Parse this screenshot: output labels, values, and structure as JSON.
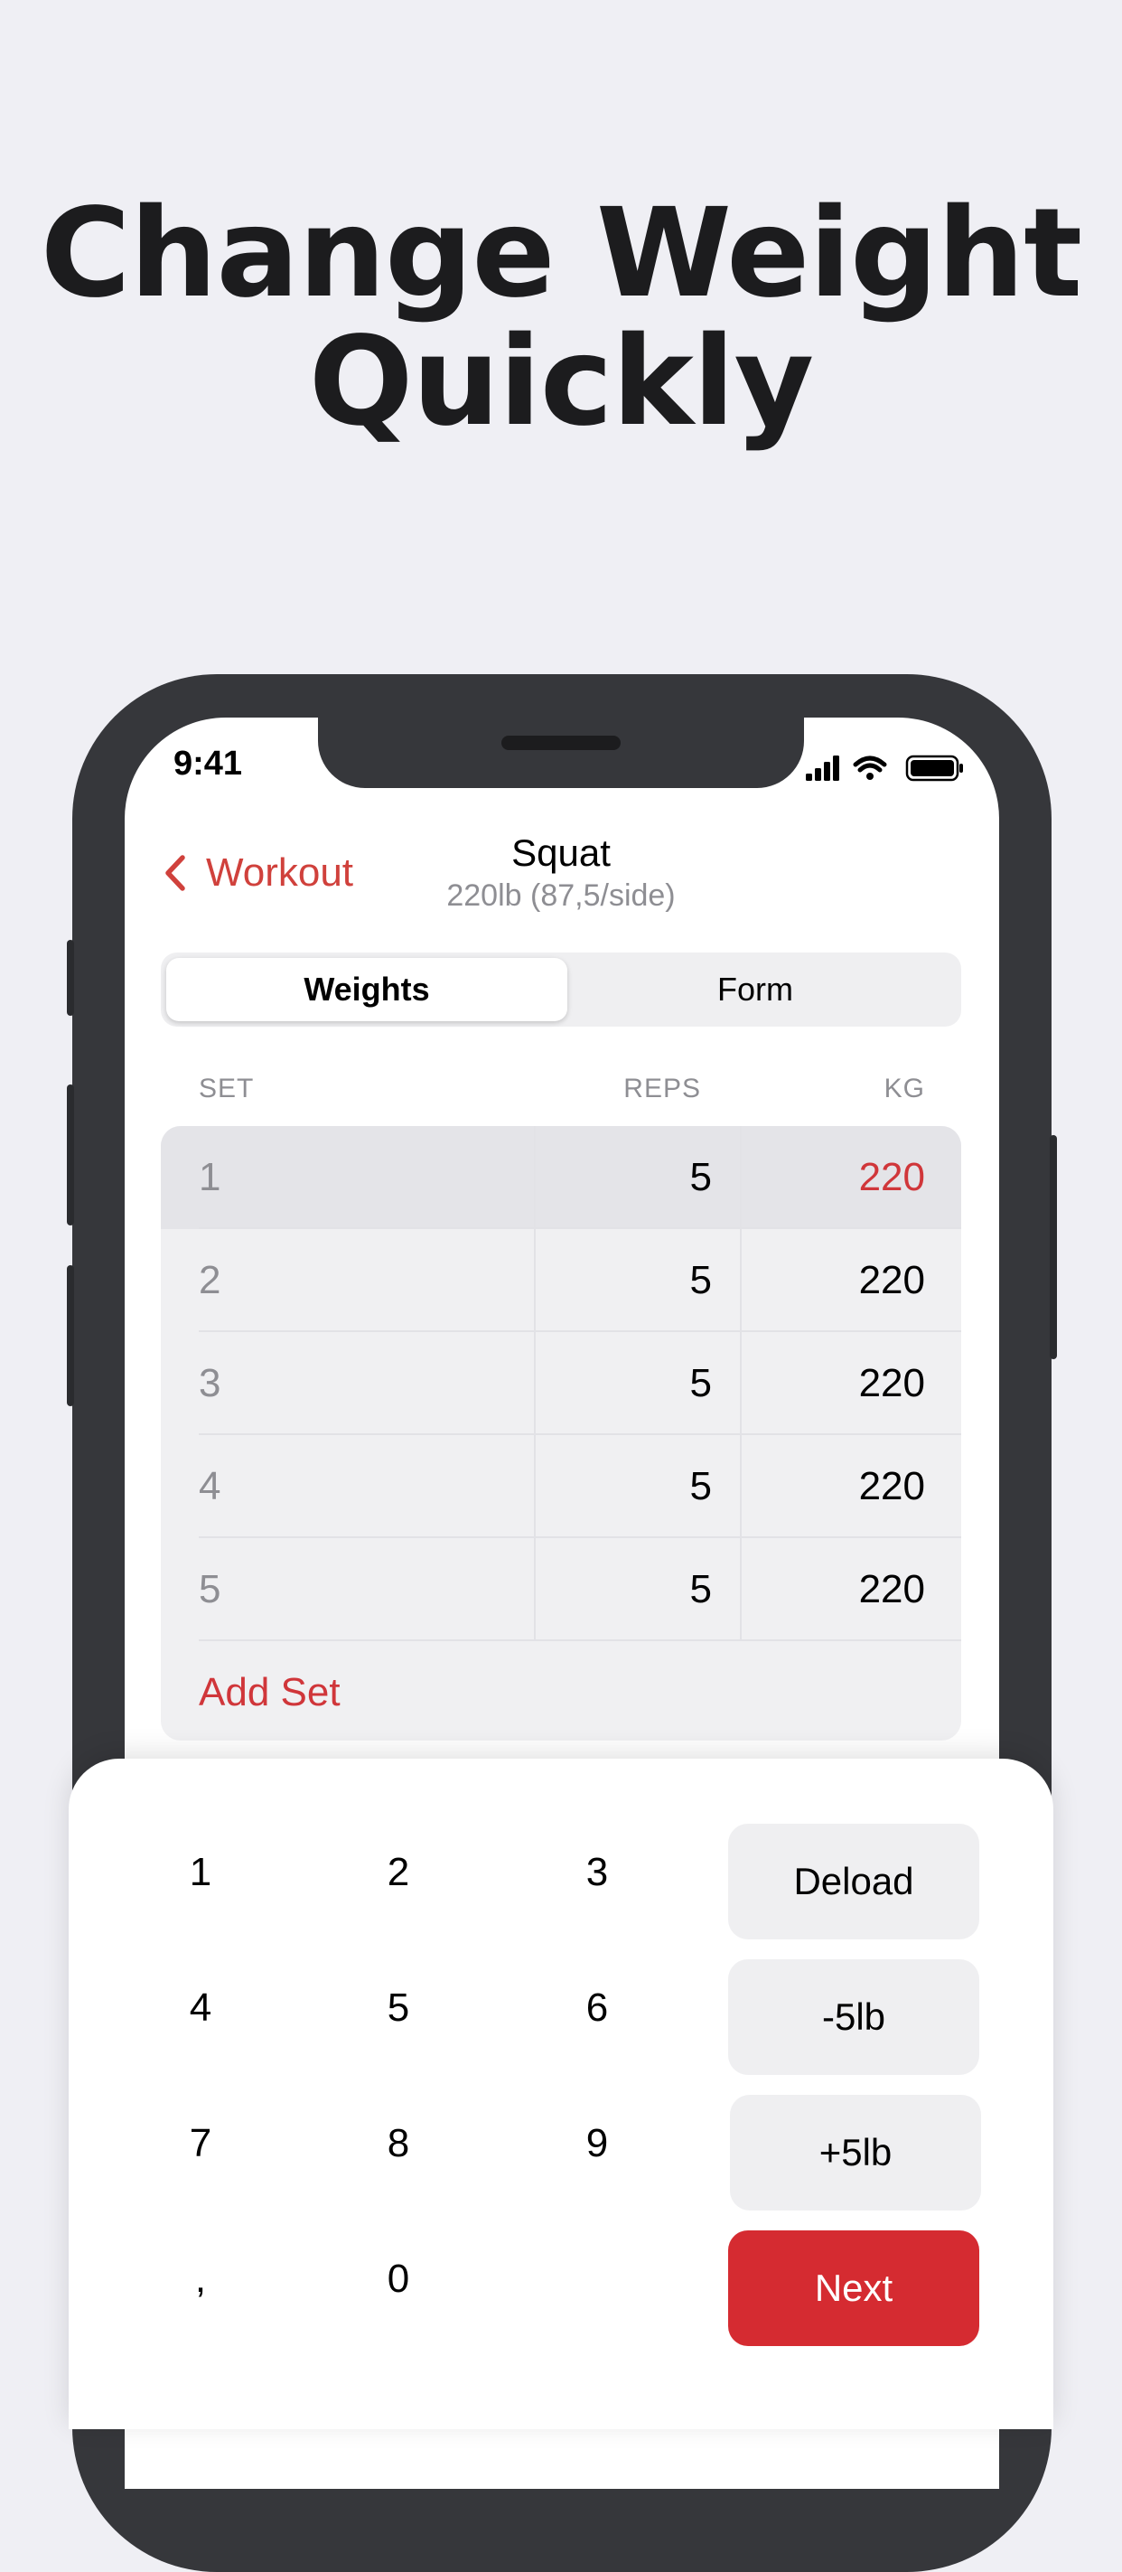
{
  "headline": {
    "line1": "Change Weight",
    "line2": "Quickly"
  },
  "status_bar": {
    "time": "9:41",
    "icons": [
      "signal-icon",
      "wifi-icon",
      "battery-icon"
    ]
  },
  "nav": {
    "back_label": "Workout",
    "title": "Squat",
    "subtitle": "220lb (87,5/side)"
  },
  "segments": {
    "weights": "Weights",
    "form": "Form",
    "selected": "Weights"
  },
  "table": {
    "headers": {
      "set": "SET",
      "reps": "REPS",
      "kg": "KG"
    },
    "rows": [
      {
        "set": "1",
        "reps": "5",
        "kg": "220",
        "selected": true
      },
      {
        "set": "2",
        "reps": "5",
        "kg": "220",
        "selected": false
      },
      {
        "set": "3",
        "reps": "5",
        "kg": "220",
        "selected": false
      },
      {
        "set": "4",
        "reps": "5",
        "kg": "220",
        "selected": false
      },
      {
        "set": "5",
        "reps": "5",
        "kg": "220",
        "selected": false
      }
    ],
    "add_set_label": "Add Set"
  },
  "keypad": {
    "digits": [
      "1",
      "2",
      "3",
      "4",
      "5",
      "6",
      "7",
      "8",
      "9",
      ",",
      "0"
    ],
    "deload": "Deload",
    "minus": "-5lb",
    "plus": "+5lb",
    "next": "Next"
  },
  "colors": {
    "accent": "#d0413c",
    "next_button": "#d52b31",
    "background": "#efeff4",
    "phone_frame": "#36373b"
  }
}
